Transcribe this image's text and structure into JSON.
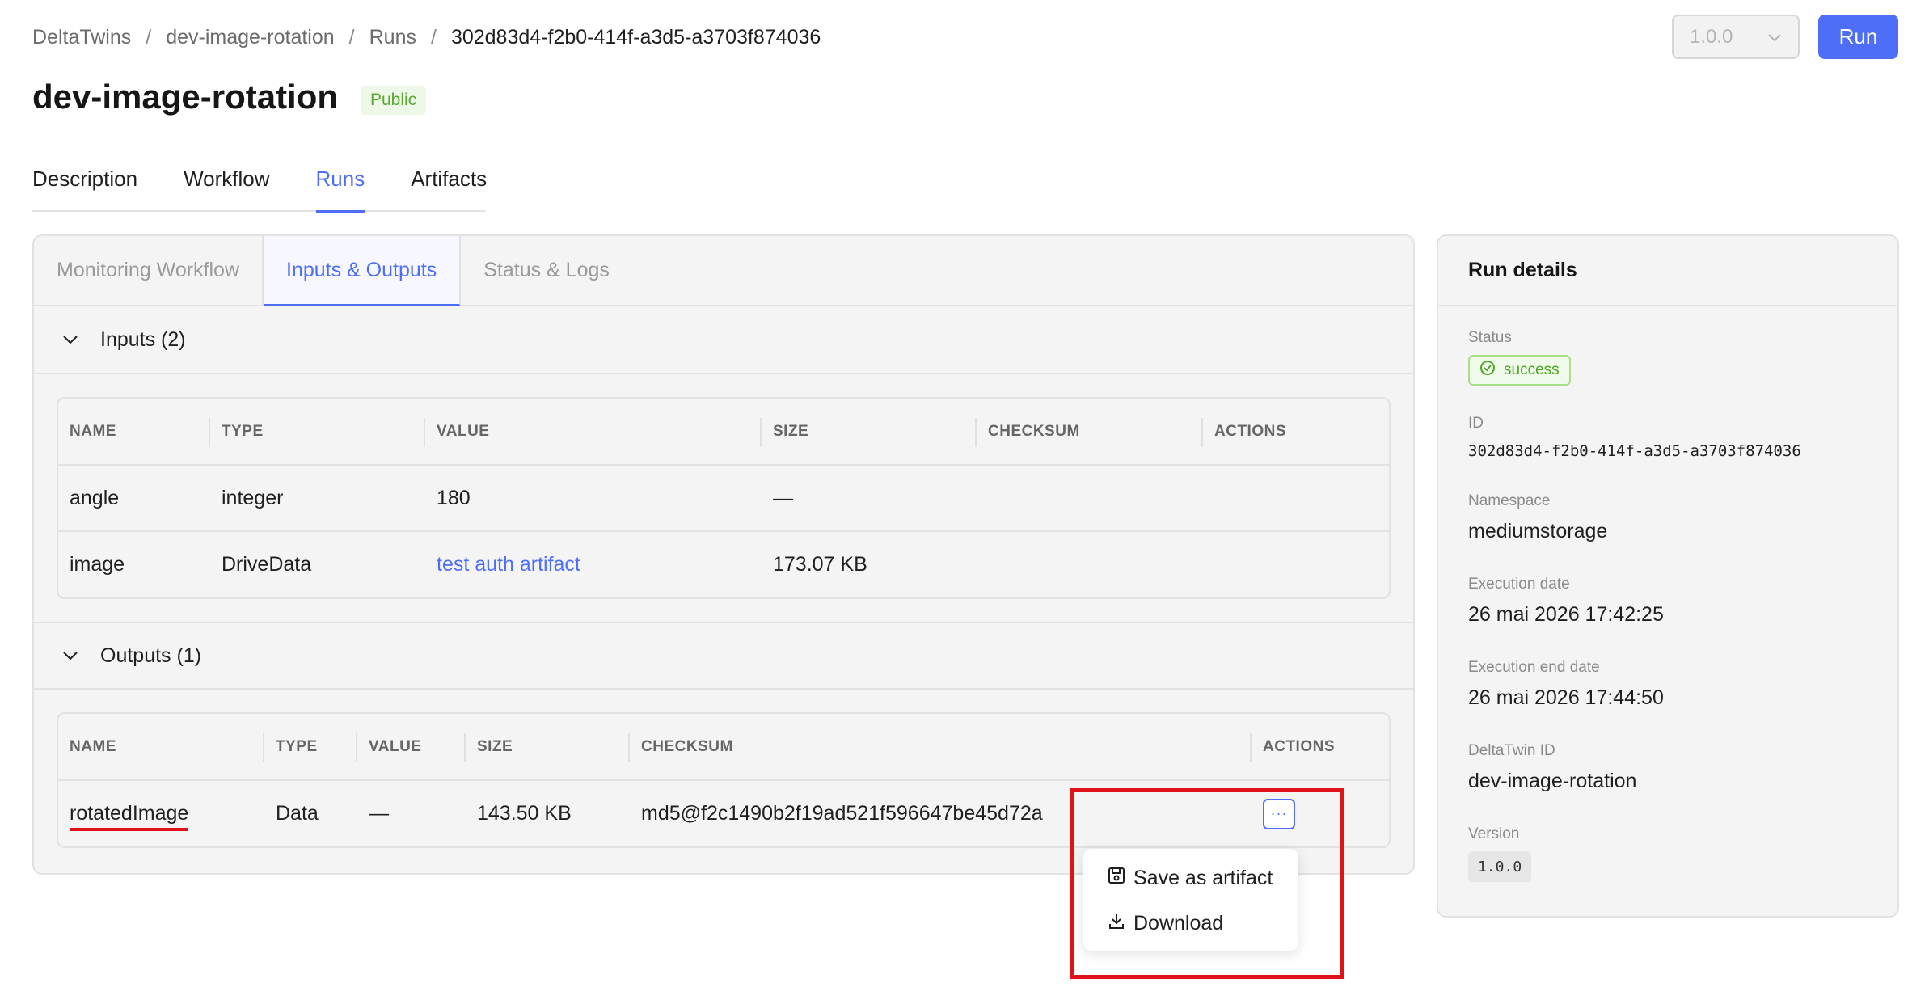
{
  "breadcrumb": [
    "DeltaTwins",
    "dev-image-rotation",
    "Runs",
    "302d83d4-f2b0-414f-a3d5-a3703f874036"
  ],
  "header": {
    "version_value": "1.0.0",
    "run_label": "Run",
    "title": "dev-image-rotation",
    "visibility_badge": "Public"
  },
  "main_tabs": [
    "Description",
    "Workflow",
    "Runs",
    "Artifacts"
  ],
  "active_main_tab": "Runs",
  "sub_tabs": [
    "Monitoring Workflow",
    "Inputs & Outputs",
    "Status & Logs"
  ],
  "active_sub_tab": "Inputs & Outputs",
  "inputs": {
    "header": "Inputs (2)",
    "columns": [
      "NAME",
      "TYPE",
      "VALUE",
      "SIZE",
      "CHECKSUM",
      "ACTIONS"
    ],
    "rows": [
      {
        "name": "angle",
        "type": "integer",
        "value": "180",
        "size": "—",
        "checksum": ""
      },
      {
        "name": "image",
        "type": "DriveData",
        "value": "test auth artifact",
        "size": "173.07 KB",
        "checksum": ""
      }
    ]
  },
  "outputs": {
    "header": "Outputs (1)",
    "columns": [
      "NAME",
      "TYPE",
      "VALUE",
      "SIZE",
      "CHECKSUM",
      "ACTIONS"
    ],
    "rows": [
      {
        "name": "rotatedImage",
        "type": "Data",
        "value": "—",
        "size": "143.50 KB",
        "checksum": "md5@f2c1490b2f19ad521f596647be45d72a",
        "actions_label": "···"
      }
    ]
  },
  "actions_menu": {
    "items": [
      {
        "label": "Save as artifact",
        "icon": "save-icon"
      },
      {
        "label": "Download",
        "icon": "download-icon"
      }
    ]
  },
  "run_details": {
    "title": "Run details",
    "status_label": "Status",
    "status_value": "success",
    "id_label": "ID",
    "id_value": "302d83d4-f2b0-414f-a3d5-a3703f874036",
    "namespace_label": "Namespace",
    "namespace_value": "mediumstorage",
    "execution_date_label": "Execution date",
    "execution_date_value": "26 mai 2026 17:42:25",
    "execution_end_label": "Execution end date",
    "execution_end_value": "26 mai 2026 17:44:50",
    "deltatwin_id_label": "DeltaTwin ID",
    "deltatwin_id_value": "dev-image-rotation",
    "version_label": "Version",
    "version_value": "1.0.0"
  },
  "colors": {
    "accent": "#4f6ef7",
    "success": "#4ca726",
    "highlight": "#e0121a"
  }
}
